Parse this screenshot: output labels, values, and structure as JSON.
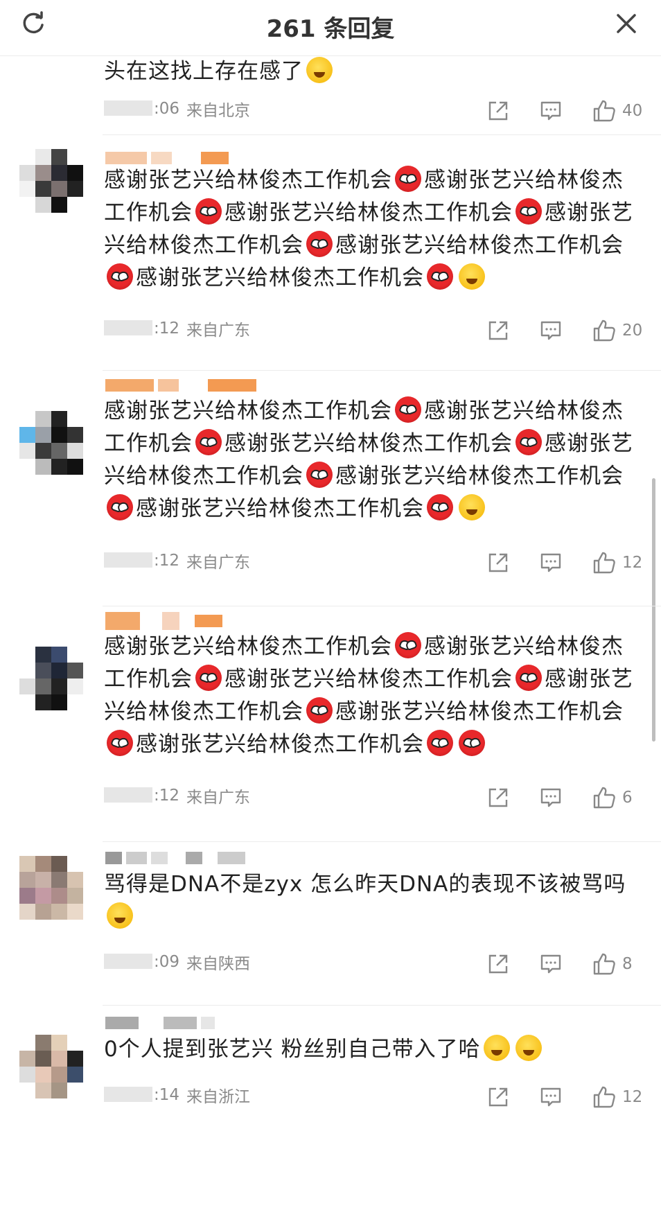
{
  "header": {
    "title": "261 条回复",
    "refresh_icon": "refresh-icon",
    "close_icon": "close-icon"
  },
  "comments": [
    {
      "text_plain": "头在这找上存在感了",
      "segments": [
        {
          "t": "头在这找上存在感了"
        },
        {
          "e": "tongue-emoji"
        }
      ],
      "time": ":06",
      "location": "来自北京",
      "likes": "40"
    },
    {
      "segments": [
        {
          "t": "感谢张艺兴给林俊杰工作机会"
        },
        {
          "e": "spider"
        },
        {
          "t": "感谢张艺兴给林俊杰工作机会"
        },
        {
          "e": "spider"
        },
        {
          "t": "感谢张艺兴给林俊杰工作机会"
        },
        {
          "e": "spider"
        },
        {
          "t": "感谢张艺兴给林俊杰工作机会"
        },
        {
          "e": "spider"
        },
        {
          "t": "感谢张艺兴给林俊杰工作机会"
        },
        {
          "e": "spider"
        },
        {
          "t": "感谢张艺兴给林俊杰工作机会"
        },
        {
          "e": "spider"
        },
        {
          "e": "heart-eyes-emoji"
        }
      ],
      "time": ":12",
      "location": "来自广东",
      "likes": "20"
    },
    {
      "segments": [
        {
          "t": "感谢张艺兴给林俊杰工作机会"
        },
        {
          "e": "spider"
        },
        {
          "t": "感谢张艺兴给林俊杰工作机会"
        },
        {
          "e": "spider"
        },
        {
          "t": "感谢张艺兴给林俊杰工作机会"
        },
        {
          "e": "spider"
        },
        {
          "t": "感谢张艺兴给林俊杰工作机会"
        },
        {
          "e": "spider"
        },
        {
          "t": "感谢张艺兴给林俊杰工作机会"
        },
        {
          "e": "spider"
        },
        {
          "t": "感谢张艺兴给林俊杰工作机会"
        },
        {
          "e": "spider"
        },
        {
          "e": "laugh-emoji"
        }
      ],
      "time": ":12",
      "location": "来自广东",
      "likes": "12"
    },
    {
      "segments": [
        {
          "t": "感谢张艺兴给林俊杰工作机会"
        },
        {
          "e": "spider"
        },
        {
          "t": "感谢张艺兴给林俊杰工作机会"
        },
        {
          "e": "spider"
        },
        {
          "t": "感谢张艺兴给林俊杰工作机会"
        },
        {
          "e": "spider"
        },
        {
          "t": "感谢张艺兴给林俊杰工作机会"
        },
        {
          "e": "spider"
        },
        {
          "t": "感谢张艺兴给林俊杰工作机会"
        },
        {
          "e": "spider"
        },
        {
          "t": "感谢张艺兴给林俊杰工作机会"
        },
        {
          "e": "spider"
        },
        {
          "e": "spider"
        }
      ],
      "time": ":12",
      "location": "来自广东",
      "likes": "6"
    },
    {
      "segments": [
        {
          "t": "骂得是DNA不是zyx 怎么昨天DNA的表现不该被骂吗"
        },
        {
          "e": "smile-emoji"
        }
      ],
      "time": ":09",
      "location": "来自陕西",
      "likes": "8"
    },
    {
      "segments": [
        {
          "t": "0个人提到张艺兴 粉丝别自己带入了哈"
        },
        {
          "e": "cry-laugh-emoji"
        },
        {
          "e": "cry-laugh-emoji"
        }
      ],
      "time": ":14",
      "location": "来自浙江",
      "likes": "12"
    }
  ],
  "icons": {
    "share": "share-icon",
    "reply": "comment-icon",
    "like": "thumbs-up-icon"
  }
}
